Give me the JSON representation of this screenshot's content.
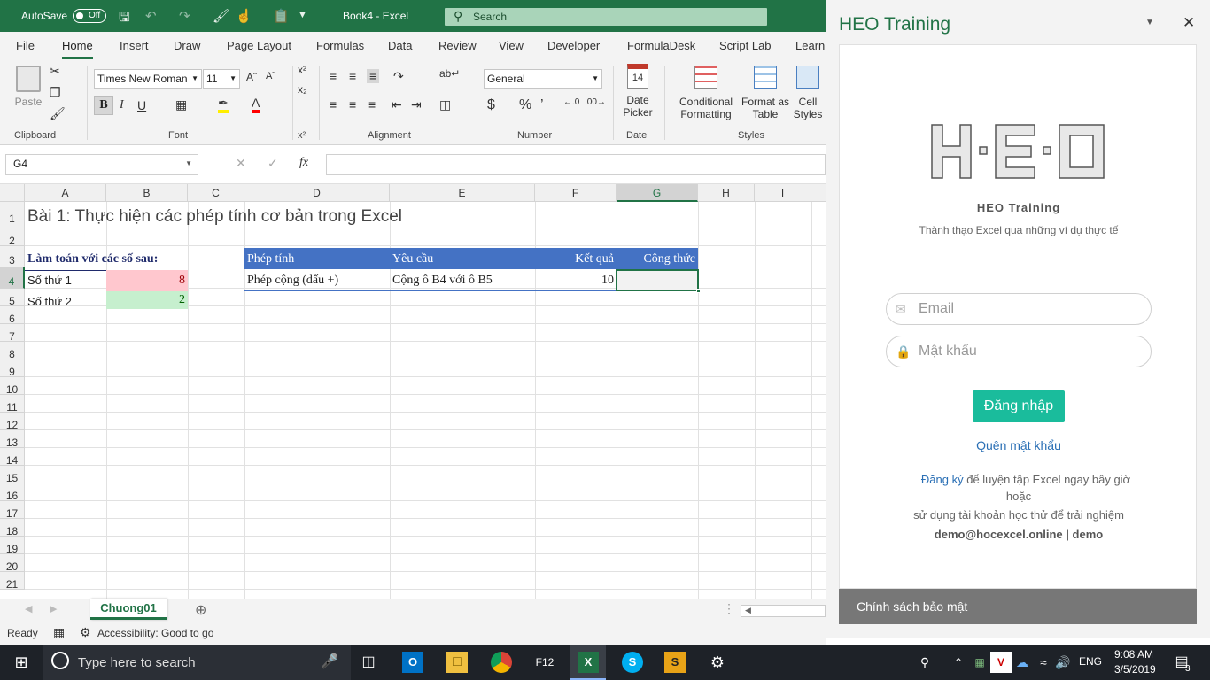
{
  "titlebar": {
    "autosave_label": "AutoSave",
    "autosave_state": "Off",
    "doc_title": "Book4  -  Excel",
    "search_placeholder": "Search"
  },
  "ribbon_tabs": [
    "File",
    "Home",
    "Insert",
    "Draw",
    "Page Layout",
    "Formulas",
    "Data",
    "Review",
    "View",
    "Developer",
    "FormulaDesk",
    "Script Lab",
    "Learn"
  ],
  "active_tab": "Home",
  "ribbon": {
    "paste_label": "Paste",
    "clipboard_group": "Clipboard",
    "font_name": "Times New Roman",
    "font_size": "11",
    "font_group": "Font",
    "bold": "B",
    "italic": "I",
    "underline": "U",
    "alignment_group": "Alignment",
    "number_format": "General",
    "number_group": "Number",
    "date_picker_line1": "Date",
    "date_picker_line2": "Picker",
    "date_group": "Date",
    "date_icon_num": "14",
    "cond_format_line1": "Conditional",
    "cond_format_line2": "Formatting",
    "format_table_line1": "Format as",
    "format_table_line2": "Table",
    "cell_styles_line1": "Cell",
    "cell_styles_line2": "Styles",
    "styles_group": "Styles"
  },
  "formula_bar": {
    "name_box": "G4",
    "fx": "fx",
    "content": ""
  },
  "columns": [
    "A",
    "B",
    "C",
    "D",
    "E",
    "F",
    "G",
    "H",
    "I"
  ],
  "selected_column": "G",
  "rows": [
    "1",
    "2",
    "3",
    "4",
    "5",
    "6",
    "7",
    "8",
    "9",
    "10",
    "11",
    "12",
    "13",
    "14",
    "15",
    "16",
    "17",
    "18",
    "19",
    "20",
    "21"
  ],
  "selected_row": "4",
  "cells": {
    "A1": "Bài 1: Thực hiện các phép tính cơ bản trong Excel",
    "A3": "Làm toán với các số sau:",
    "A4": "Số thứ 1",
    "B4": "8",
    "A5": "Số thứ 2",
    "B5": "2",
    "D3": "Phép tính",
    "E3": "Yêu cầu",
    "F3": "Kết quả",
    "G3": "Công thức",
    "D4": "Phép cộng (dấu +)",
    "E4": "Cộng ô B4 với ô B5",
    "F4": "10"
  },
  "colors": {
    "excel_green": "#217346",
    "header_blue": "#4472c4",
    "pink_fill": "#ffc7ce",
    "green_fill": "#c6efce",
    "heo_teal": "#1abc9c"
  },
  "sheet_tab": "Chuong01",
  "status": {
    "ready": "Ready",
    "accessibility": "Accessibility: Good to go"
  },
  "panel": {
    "title": "HEO Training",
    "brand": "HEO Training",
    "tagline": "Thành thạo Excel qua những ví dụ thực tế",
    "email_placeholder": "Email",
    "password_placeholder": "Mật khẩu",
    "login_button": "Đăng nhập",
    "forgot": "Quên mật khẩu",
    "register_link": "Đăng ký",
    "register_text": " để luyện tập Excel ngay bây giờ",
    "or": "hoặc",
    "demo_text": "sử dụng tài khoản học thử để trải nghiệm",
    "demo_account": "demo@hocexcel.online | demo",
    "footer": "Chính sách bảo mật"
  },
  "taskbar": {
    "search_placeholder": "Type here to search",
    "f12": "F12",
    "lang": "ENG",
    "time": "9:08 AM",
    "date": "3/5/2019",
    "notif_count": "3"
  }
}
